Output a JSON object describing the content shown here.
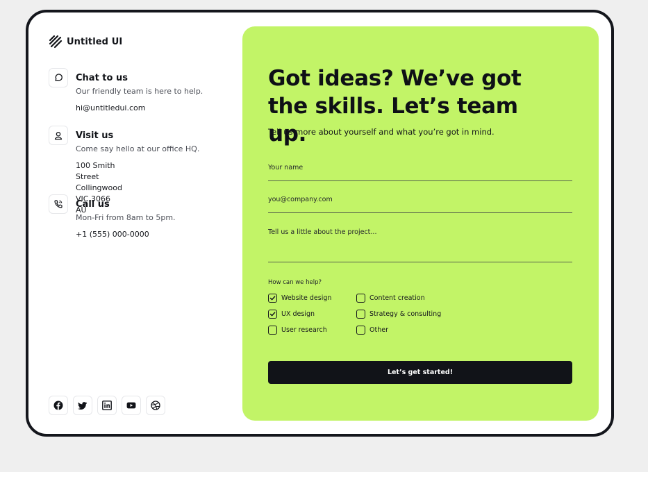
{
  "brand": {
    "name": "Untitled UI",
    "icon": "untitled-ui-logo"
  },
  "contacts": [
    {
      "icon": "chat-icon",
      "title": "Chat to us",
      "subtitle": "Our friendly team is here to help.",
      "detail": "hi@untitledui.com"
    },
    {
      "icon": "map-pin-icon",
      "title": "Visit us",
      "subtitle": "Come say hello at our office HQ.",
      "detail": "100 Smith Street\nCollingwood VIC 3066 AU"
    },
    {
      "icon": "phone-icon",
      "title": "Call us",
      "subtitle": "Mon-Fri from 8am to 5pm.",
      "detail": "+1 (555) 000-0000"
    }
  ],
  "socials": [
    "facebook-icon",
    "twitter-icon",
    "linkedin-icon",
    "youtube-icon",
    "dribbble-icon"
  ],
  "form": {
    "headline": "Got ideas? We’ve got the skills. Let’s team up.",
    "subhead": "Tell us more about yourself and what you’re got in mind.",
    "name_placeholder": "Your name",
    "email_placeholder": "you@company.com",
    "project_placeholder": "Tell us a little about the project...",
    "help_label": "How can we help?",
    "options": [
      {
        "label": "Website design",
        "checked": true
      },
      {
        "label": "UX design",
        "checked": true
      },
      {
        "label": "User research",
        "checked": false
      },
      {
        "label": "Content creation",
        "checked": false
      },
      {
        "label": "Strategy & consulting",
        "checked": false
      },
      {
        "label": "Other",
        "checked": false
      }
    ],
    "submit_label": "Let’s get started!"
  },
  "colors": {
    "panel": "#c2f467",
    "dark": "#111318",
    "page_bg": "#efefef"
  }
}
